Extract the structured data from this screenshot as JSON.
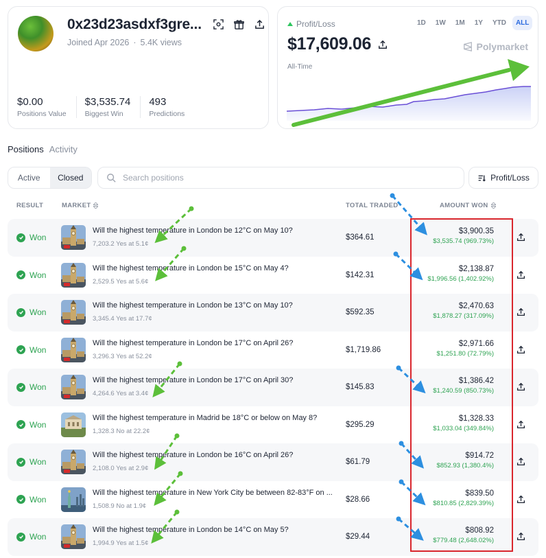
{
  "profile": {
    "username": "0x23d23asdxf3gre...",
    "joined": "Joined Apr 2026",
    "separator": "·",
    "views": "5.4K views",
    "stats": [
      {
        "value": "$0.00",
        "label": "Positions Value"
      },
      {
        "value": "$3,535.74",
        "label": "Biggest Win"
      },
      {
        "value": "493",
        "label": "Predictions"
      }
    ]
  },
  "pnl": {
    "label": "Profit/Loss",
    "value": "$17,609.06",
    "period_label": "All-Time",
    "brand": "Polymarket",
    "periods": [
      "1D",
      "1W",
      "1M",
      "1Y",
      "YTD",
      "ALL"
    ],
    "active_period": "ALL"
  },
  "tabs": {
    "positions": "Positions",
    "activity": "Activity"
  },
  "toolbar": {
    "active": "Active",
    "closed": "Closed",
    "search_placeholder": "Search positions",
    "sort_label": "Profit/Loss"
  },
  "table": {
    "headers": {
      "result": "RESULT",
      "market": "MARKET",
      "total_traded": "TOTAL TRADED",
      "amount_won": "AMOUNT WON"
    },
    "rows": [
      {
        "result": "Won",
        "question": "Will the highest temperature in London be 12°C on May 10?",
        "detail": "7,203.2 Yes at 5.1¢",
        "traded": "$364.61",
        "amount": "$3,900.35",
        "pnl": "$3,535.74 (969.73%)",
        "thumb": "bigben"
      },
      {
        "result": "Won",
        "question": "Will the highest temperature in London be 15°C on May 4?",
        "detail": "2,529.5 Yes at 5.6¢",
        "traded": "$142.31",
        "amount": "$2,138.87",
        "pnl": "$1,996.56 (1,402.92%)",
        "thumb": "bigben"
      },
      {
        "result": "Won",
        "question": "Will the highest temperature in London be 13°C on May 10?",
        "detail": "3,345.4 Yes at 17.7¢",
        "traded": "$592.35",
        "amount": "$2,470.63",
        "pnl": "$1,878.27 (317.09%)",
        "thumb": "bigben"
      },
      {
        "result": "Won",
        "question": "Will the highest temperature in London be 17°C on April 26?",
        "detail": "3,296.3 Yes at 52.2¢",
        "traded": "$1,719.86",
        "amount": "$2,971.66",
        "pnl": "$1,251.80 (72.79%)",
        "thumb": "bigben"
      },
      {
        "result": "Won",
        "question": "Will the highest temperature in London be 17°C on April 30?",
        "detail": "4,264.6 Yes at 3.4¢",
        "traded": "$145.83",
        "amount": "$1,386.42",
        "pnl": "$1,240.59 (850.73%)",
        "thumb": "bigben"
      },
      {
        "result": "Won",
        "question": "Will the highest temperature in Madrid be 18°C or below on May 8?",
        "detail": "1,328.3 No at 22.2¢",
        "traded": "$295.29",
        "amount": "$1,328.33",
        "pnl": "$1,033.04 (349.84%)",
        "thumb": "madrid"
      },
      {
        "result": "Won",
        "question": "Will the highest temperature in London be 16°C on April 26?",
        "detail": "2,108.0 Yes at 2.9¢",
        "traded": "$61.79",
        "amount": "$914.72",
        "pnl": "$852.93 (1,380.4%)",
        "thumb": "bigben"
      },
      {
        "result": "Won",
        "question": "Will the highest temperature in New York City be between 82-83°F on ...",
        "detail": "1,508.9 No at 1.9¢",
        "traded": "$28.66",
        "amount": "$839.50",
        "pnl": "$810.85 (2,829.39%)",
        "thumb": "liberty"
      },
      {
        "result": "Won",
        "question": "Will the highest temperature in London be 14°C on May 5?",
        "detail": "1,994.9 Yes at 1.5¢",
        "traded": "$29.44",
        "amount": "$808.92",
        "pnl": "$779.48 (2,648.02%)",
        "thumb": "bigben"
      }
    ]
  },
  "colors": {
    "positive": "#2ea352",
    "accent": "#2d6cdf",
    "chart_line": "#6a4fd6",
    "annotation_green": "#5cbf3a",
    "annotation_blue": "#2d8fe0",
    "annotation_red": "#d9262d"
  }
}
